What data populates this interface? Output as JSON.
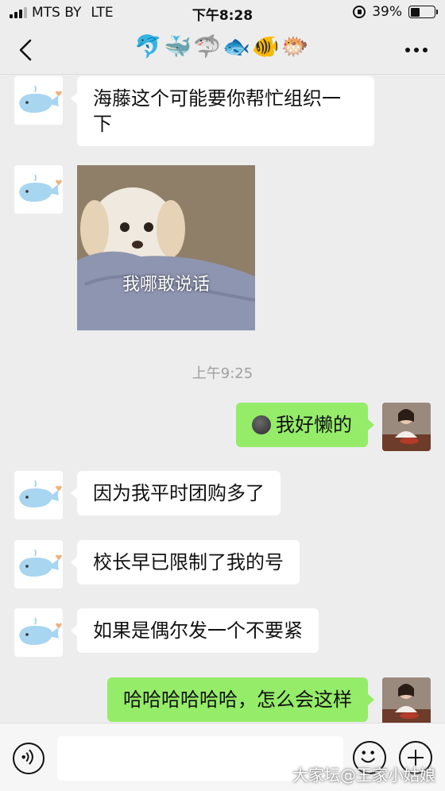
{
  "status_bar": {
    "carrier": "MTS BY",
    "network": "LTE",
    "time": "下午8:28",
    "battery_text": "39%",
    "battery_level": 0.39
  },
  "nav": {
    "title": "🐬🐳🦈🐟🐠🐡",
    "back_icon": "chevron-left-icon",
    "more_icon": "more-dots-icon"
  },
  "messages": [
    {
      "side": "in",
      "text": "海藤这个可能要你帮忙组织一下"
    },
    {
      "side": "in",
      "type": "sticker",
      "caption": "我哪敢说话"
    },
    {
      "type": "time",
      "text": "上午9:25"
    },
    {
      "side": "out",
      "text": "我好懒的",
      "emoji": "new-moon-face-icon"
    },
    {
      "side": "in",
      "text": "因为我平时团购多了"
    },
    {
      "side": "in",
      "text": "校长早已限制了我的号"
    },
    {
      "side": "in",
      "text": "如果是偶尔发一个不要紧"
    },
    {
      "side": "out",
      "text": "哈哈哈哈哈哈，怎么会这样"
    }
  ],
  "input_bar": {
    "placeholder": "",
    "voice_icon": "voice-icon",
    "emoji_icon": "emoji-icon",
    "plus_icon": "plus-icon"
  },
  "watermark": "大家坛@王家小姑娘",
  "colors": {
    "background": "#ededed",
    "bubble_in": "#ffffff",
    "bubble_out": "#95ec69"
  }
}
